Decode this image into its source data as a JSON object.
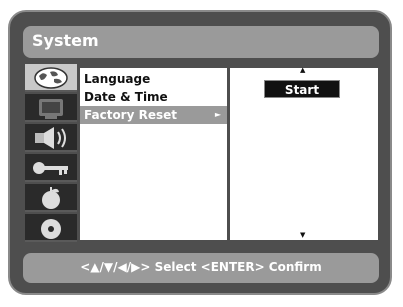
{
  "window": {
    "title": "System"
  },
  "sidebar": {
    "tabs": [
      {
        "icon": "globe-icon",
        "selected": true
      },
      {
        "icon": "tv-icon",
        "selected": false
      },
      {
        "icon": "speaker-icon",
        "selected": false
      },
      {
        "icon": "key-icon",
        "selected": false
      },
      {
        "icon": "apple-icon",
        "selected": false
      },
      {
        "icon": "disc-icon",
        "selected": false
      }
    ]
  },
  "menu": {
    "items": [
      {
        "label": "Language",
        "selected": false
      },
      {
        "label": "Date & Time",
        "selected": false
      },
      {
        "label": "Factory Reset",
        "selected": true,
        "has_submenu": true
      }
    ],
    "submenu_arrow": "►"
  },
  "panel": {
    "scroll_up": "▲",
    "scroll_down": "▼",
    "start_label": "Start"
  },
  "footer": {
    "hint": "<▲/▼/◀/▶> Select  <ENTER> Confirm"
  },
  "colors": {
    "frame": "#4e4e4e",
    "bar": "#9a9a9a",
    "tab_dark": "#2a2a2a",
    "tab_selected": "#c9c9c9",
    "highlight": "#9a9a9a"
  }
}
